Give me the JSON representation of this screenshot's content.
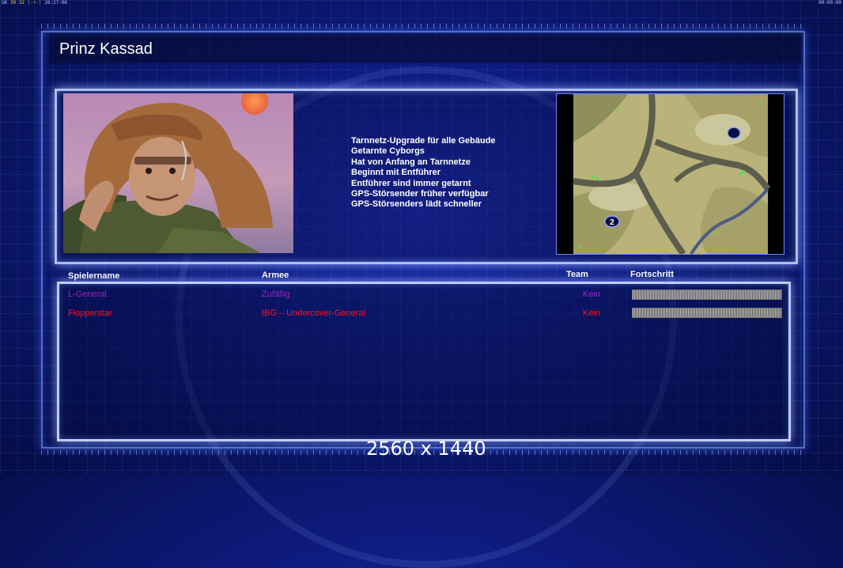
{
  "topbar": {
    "left_prefix": "UK",
    "left_a": "30",
    "left_b": "32",
    "left_c": "|-+-|",
    "left_time": "20:27:06",
    "right_time": "00:00:00"
  },
  "title": "Prinz Kassad",
  "features": [
    "Tarnnetz-Upgrade für alle Gebäude",
    "Getarnte Cyborgs",
    "Hat von Anfang an Tarnnetze",
    "Beginnt mit Entführer",
    "Entführer sind immer getarnt",
    "GPS-Störsender früher verfügbar",
    "GPS-Störsenders lädt schneller"
  ],
  "map": {
    "marker_label": "2"
  },
  "table": {
    "headers": {
      "player": "Spielername",
      "army": "Armee",
      "team": "Team",
      "progress": "Fortschritt"
    },
    "rows": [
      {
        "player": "L-General",
        "army": "Zufällig",
        "team": "Kein",
        "color": "#a020c8"
      },
      {
        "player": "Flopperstar",
        "army": "IBG – Undercover-General",
        "team": "Kein",
        "color": "#ff1020"
      }
    ]
  },
  "resolution": "2560 x 1440"
}
